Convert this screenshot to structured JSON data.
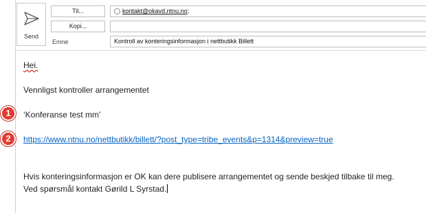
{
  "header": {
    "send_label": "Send",
    "to_button": "Til...",
    "cc_button": "Kopi...",
    "subject_label": "Emne",
    "to_recipient": "kontakt@okavd.ntnu.no",
    "to_separator": ";",
    "cc_value": "",
    "subject_value": "Kontroll av konteringsinformasjon i nettbutikk Billett"
  },
  "body": {
    "greeting": "Hei.",
    "line1": "Vennligst kontroller arrangementet",
    "event_name": "‘Konferanse test mm’",
    "link": "https://www.ntnu.no/nettbutikk/billett/?post_type=tribe_events&p=1314&preview=true",
    "line2": "Hvis konteringsinformasjon er OK kan dere publisere arrangementet og sende beskjed tilbake til meg.",
    "line3": "Ved spørsmål kontakt Gørild L Syrstad."
  },
  "markers": [
    "1",
    "2"
  ],
  "colors": {
    "marker": "#e53a2f",
    "link": "#0563c1"
  }
}
